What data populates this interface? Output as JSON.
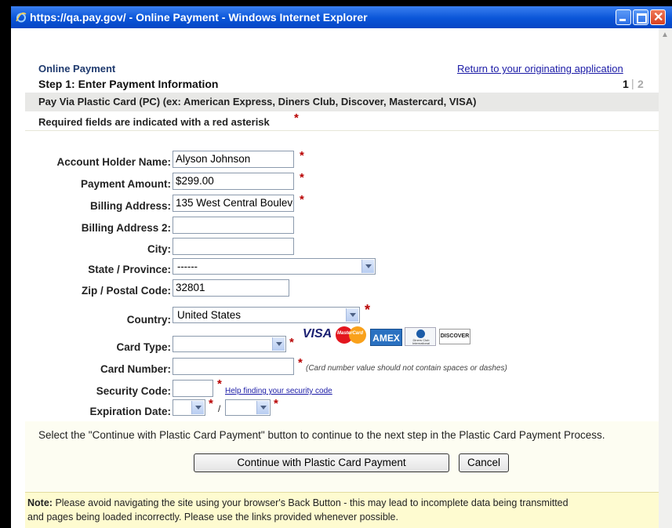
{
  "window": {
    "title": "https://qa.pay.gov/ - Online Payment - Windows Internet Explorer"
  },
  "header": {
    "app_name": "Online Payment",
    "return_link": "Return to your originating application",
    "step_title": "Step 1: Enter Payment Information",
    "step_current": "1",
    "step_separator": "|",
    "step_next": "2",
    "pay_via": "Pay Via Plastic Card (PC) (ex: American Express, Diners Club, Discover, Mastercard, VISA)",
    "required_note": "Required fields are indicated with a red asterisk",
    "asterisk": "*"
  },
  "form": {
    "account_holder_label": "Account Holder Name:",
    "account_holder_value": "Alyson Johnson",
    "payment_amount_label": "Payment Amount:",
    "payment_amount_value": "$299.00",
    "billing_address_label": "Billing Address:",
    "billing_address_value": "135 West Central Boulev",
    "billing_address2_label": "Billing Address 2:",
    "billing_address2_value": "",
    "city_label": "City:",
    "city_value": "",
    "state_label": "State / Province:",
    "state_value": "------",
    "zip_label": "Zip / Postal Code:",
    "zip_value": "32801",
    "country_label": "Country:",
    "country_value": "United States",
    "card_type_label": "Card Type:",
    "card_type_value": "",
    "card_number_label": "Card Number:",
    "card_number_value": "",
    "card_number_hint": "(Card number value should not contain spaces or dashes)",
    "security_code_label": "Security Code:",
    "security_code_value": "",
    "security_help_link": "Help finding your security code",
    "expiration_label": "Expiration Date:",
    "expiration_separator": "/"
  },
  "card_logos": {
    "visa": "VISA",
    "mastercard": "MasterCard",
    "amex": "AMEX",
    "diners": "Diners Club International",
    "discover": "DISCOVER"
  },
  "instructions": "Select the \"Continue with Plastic Card Payment\" button to continue to the next step in the Plastic Card Payment Process.",
  "buttons": {
    "continue": "Continue with Plastic Card Payment",
    "cancel": "Cancel"
  },
  "note": {
    "label": "Note:",
    "line1": "Please avoid navigating the site using your browser's Back Button - this may lead to incomplete data being transmitted",
    "line2": "and pages being loaded incorrectly. Please use the links provided whenever possible."
  },
  "colors": {
    "asterisk": "#b80000",
    "link": "#1a1aa6",
    "title_bar": "#0a55d8",
    "note_bg": "#fefbd0"
  }
}
